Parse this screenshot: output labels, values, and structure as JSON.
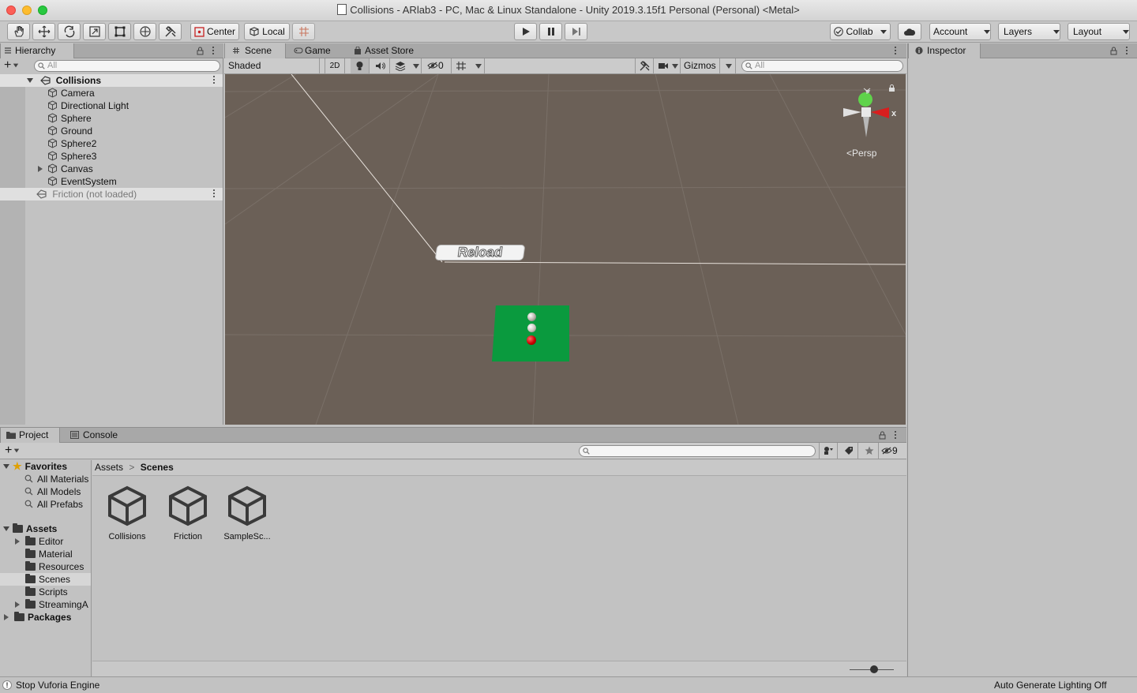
{
  "window": {
    "title": "Collisions - ARlab3 - PC, Mac & Linux Standalone - Unity 2019.3.15f1 Personal (Personal) <Metal>"
  },
  "toolbar": {
    "pivot_label": "Center",
    "space_label": "Local",
    "collab_label": "Collab",
    "account_label": "Account",
    "layers_label": "Layers",
    "layout_label": "Layout"
  },
  "hierarchy": {
    "tab_label": "Hierarchy",
    "search_placeholder": "All",
    "scene_name": "Collisions",
    "items": [
      {
        "label": "Camera"
      },
      {
        "label": "Directional Light"
      },
      {
        "label": "Sphere"
      },
      {
        "label": "Ground"
      },
      {
        "label": "Sphere2"
      },
      {
        "label": "Sphere3"
      },
      {
        "label": "Canvas"
      },
      {
        "label": "EventSystem"
      }
    ],
    "unloaded_scene": "Friction (not loaded)"
  },
  "scene_view": {
    "tabs": [
      {
        "label": "Scene"
      },
      {
        "label": "Game"
      },
      {
        "label": "Asset Store"
      }
    ],
    "shading_mode": "Shaded",
    "mode_2d": "2D",
    "hidden_count": "0",
    "gizmos_label": "Gizmos",
    "search_placeholder": "All",
    "projection_label": "Persp",
    "axis_x": "x",
    "axis_y": "y",
    "reload_button_text": "Reload"
  },
  "inspector": {
    "tab_label": "Inspector"
  },
  "project": {
    "tabs": [
      {
        "label": "Project"
      },
      {
        "label": "Console"
      }
    ],
    "badge_count": "9",
    "favorites": {
      "label": "Favorites",
      "items": [
        {
          "label": "All Materials"
        },
        {
          "label": "All Models"
        },
        {
          "label": "All Prefabs"
        }
      ]
    },
    "assets": {
      "label": "Assets",
      "items": [
        {
          "label": "Editor"
        },
        {
          "label": "Material"
        },
        {
          "label": "Resources"
        },
        {
          "label": "Scenes"
        },
        {
          "label": "Scripts"
        },
        {
          "label": "StreamingA"
        }
      ]
    },
    "packages_label": "Packages",
    "breadcrumb": {
      "root": "Assets",
      "current": "Scenes"
    },
    "files": [
      {
        "label": "Collisions"
      },
      {
        "label": "Friction"
      },
      {
        "label": "SampleSc..."
      }
    ]
  },
  "status": {
    "left_text": "Stop Vuforia Engine",
    "right_text": "Auto Generate Lighting Off"
  },
  "colors": {
    "scene_bg": "#6b6057",
    "ground_green": "#0a9a3e",
    "sphere_red": "#cc0000",
    "gizmo_green": "#5fd34a",
    "gizmo_red": "#d81e1e"
  }
}
